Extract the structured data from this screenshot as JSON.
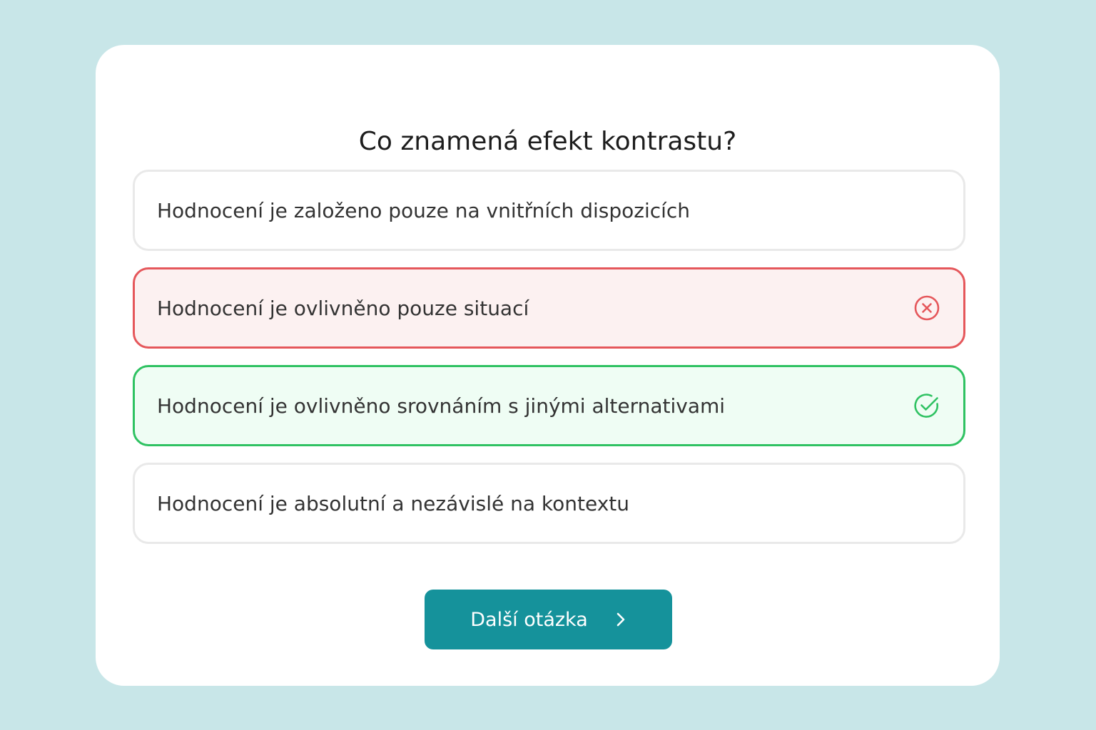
{
  "quiz": {
    "question": "Co znamená efekt kontrastu?",
    "options": [
      {
        "label": "Hodnocení je založeno pouze na vnitřních dispozicích",
        "state": "neutral"
      },
      {
        "label": "Hodnocení je ovlivněno pouze situací",
        "state": "wrong",
        "icon": "x-circle-icon"
      },
      {
        "label": "Hodnocení je ovlivněno srovnáním s jinými alternativami",
        "state": "correct",
        "icon": "check-circle-icon"
      },
      {
        "label": "Hodnocení je absolutní a nezávislé na kontextu",
        "state": "neutral"
      }
    ],
    "next_button_label": "Další otázka",
    "next_button_icon": "chevron-right-icon"
  },
  "colors": {
    "background": "#c8e6e8",
    "card": "#ffffff",
    "accent": "#15929b",
    "wrong_border": "#e5575b",
    "wrong_fill": "#fcf1f1",
    "correct_border": "#2fc262",
    "correct_fill": "#effdf4"
  }
}
